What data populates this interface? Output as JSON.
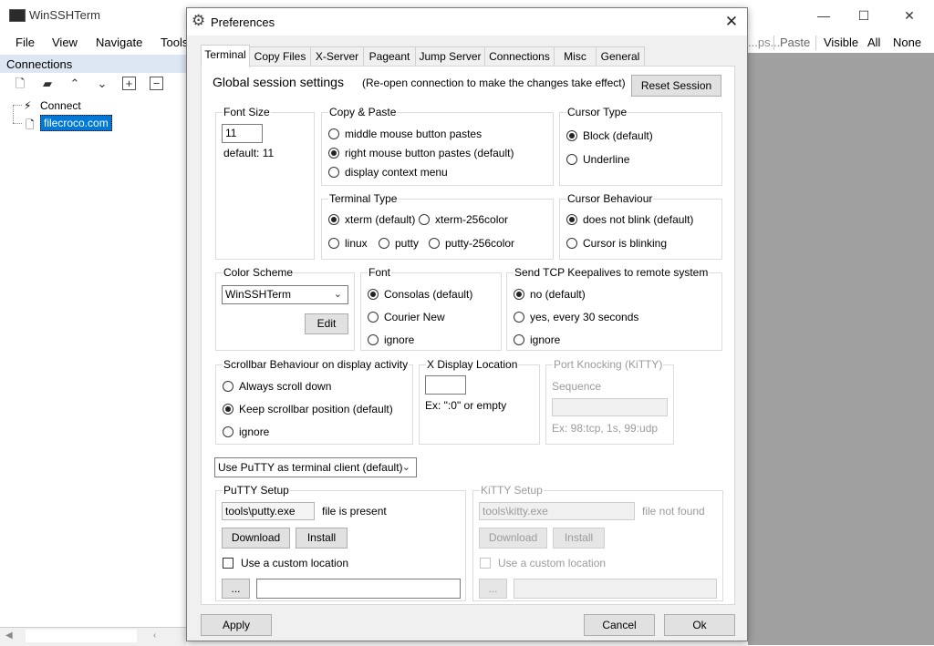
{
  "window": {
    "title": "WinSSHTerm",
    "controls": {
      "minimize": "—",
      "maximize": "☐",
      "close": "✕"
    },
    "menu": [
      "File",
      "View",
      "Navigate",
      "Tools"
    ],
    "right_toolbar": [
      "Paste",
      "Visible",
      "All",
      "None"
    ],
    "right_toolbar_partial": "...ps..."
  },
  "connections": {
    "header": "Connections",
    "toolbar_icons": [
      "new-connection-icon",
      "new-folder-icon",
      "move-up-icon",
      "move-down-icon",
      "expand-all-icon",
      "collapse-all-icon"
    ],
    "tree": [
      {
        "label": "Connect",
        "icon": "plug-icon"
      },
      {
        "label": "filecroco.com",
        "icon": "file-icon",
        "selected": true
      }
    ]
  },
  "dialog": {
    "title": "Preferences",
    "tabs": [
      "Terminal",
      "Copy Files",
      "X-Server",
      "Pageant",
      "Jump Server",
      "Connections",
      "Misc",
      "General"
    ],
    "active_tab": "Terminal",
    "global_title": "Global session settings",
    "global_note": "(Re-open connection to make the changes take effect)",
    "reset_button": "Reset Session",
    "font_size": {
      "title": "Font Size",
      "value": "11",
      "default_text": "default: 11"
    },
    "copy_paste": {
      "title": "Copy & Paste",
      "options": [
        "middle mouse button pastes",
        "right mouse button pastes (default)",
        "display context menu"
      ],
      "selected": 1
    },
    "cursor_type": {
      "title": "Cursor Type",
      "options": [
        "Block (default)",
        "Underline"
      ],
      "selected": 0
    },
    "terminal_type": {
      "title": "Terminal Type",
      "options": [
        "xterm (default)",
        "xterm-256color",
        "linux",
        "putty",
        "putty-256color"
      ],
      "selected": 0
    },
    "cursor_behaviour": {
      "title": "Cursor Behaviour",
      "options": [
        "does not blink (default)",
        "Cursor is blinking"
      ],
      "selected": 0
    },
    "color_scheme": {
      "title": "Color Scheme",
      "value": "WinSSHTerm",
      "edit_button": "Edit"
    },
    "font": {
      "title": "Font",
      "options": [
        "Consolas (default)",
        "Courier New",
        "ignore"
      ],
      "selected": 0
    },
    "keepalive": {
      "title": "Send TCP Keepalives to remote system",
      "options": [
        "no (default)",
        "yes, every 30 seconds",
        "ignore"
      ],
      "selected": 0
    },
    "scrollbar": {
      "title": "Scrollbar Behaviour on display activity",
      "options": [
        "Always scroll down",
        "Keep scrollbar position (default)",
        "ignore"
      ],
      "selected": 1
    },
    "x_display": {
      "title": "X Display Location",
      "value": "",
      "hint": "Ex: \":0\" or empty"
    },
    "port_knocking": {
      "title": "Port Knocking (KiTTY)",
      "sequence_label": "Sequence",
      "value": "",
      "hint": "Ex: 98:tcp, 1s, 99:udp"
    },
    "terminal_client": "Use PuTTY as terminal client (default)",
    "putty_setup": {
      "title": "PuTTY Setup",
      "path": "tools\\putty.exe",
      "status": "file is present",
      "download": "Download",
      "install": "Install",
      "custom_label": "Use a custom location",
      "browse": "...",
      "custom_path": ""
    },
    "kitty_setup": {
      "title": "KiTTY Setup",
      "path": "tools\\kitty.exe",
      "status": "file not found",
      "download": "Download",
      "install": "Install",
      "custom_label": "Use a custom location",
      "browse": "...",
      "custom_path": ""
    },
    "buttons": {
      "apply": "Apply",
      "cancel": "Cancel",
      "ok": "Ok"
    }
  }
}
